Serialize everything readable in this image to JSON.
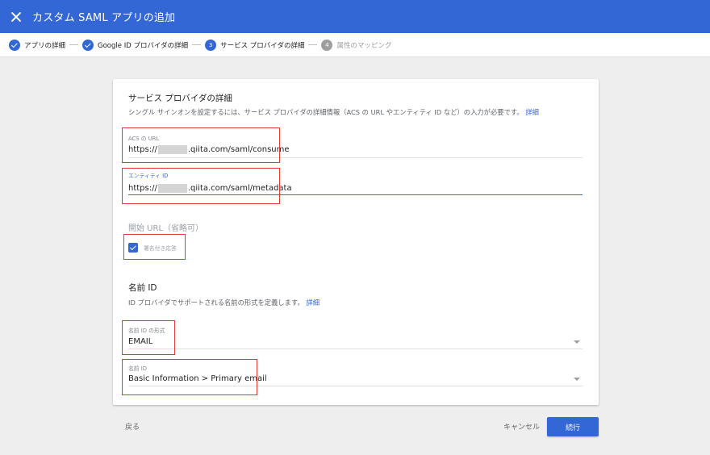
{
  "header": {
    "title": "カスタム SAML アプリの追加",
    "close_icon": "close-icon"
  },
  "stepper": {
    "steps": [
      {
        "label": "アプリの詳細",
        "status": "done"
      },
      {
        "label": "Google ID プロバイダの詳細",
        "status": "done"
      },
      {
        "label": "サービス プロバイダの詳細",
        "status": "current",
        "number": "3"
      },
      {
        "label": "属性のマッピング",
        "status": "pending",
        "number": "4"
      }
    ]
  },
  "service_provider": {
    "title": "サービス プロバイダの詳細",
    "description": "シングル サインオンを設定するには、サービス プロバイダの詳細情報（ACS の URL やエンティティ ID など）の入力が必要です。",
    "details_link": "詳細",
    "acs_url": {
      "label": "ACS の URL",
      "value_prefix": "https://",
      "value_suffix": ".qiita.com/saml/consume"
    },
    "entity_id": {
      "label": "エンティティ ID",
      "value_prefix": "https://",
      "value_suffix": ".qiita.com/saml/metadata"
    },
    "start_url": {
      "placeholder": "開始 URL（省略可）"
    },
    "signed_response": {
      "label": "署名付き応答",
      "checked": true
    }
  },
  "name_id": {
    "title": "名前 ID",
    "description": "ID プロバイダでサポートされる名前の形式を定義します。",
    "details_link": "詳細",
    "format": {
      "label": "名前 ID の形式",
      "value": "EMAIL"
    },
    "name_id_field": {
      "label": "名前 ID",
      "value": "Basic Information > Primary email"
    }
  },
  "footer": {
    "back_label": "戻る",
    "cancel_label": "キャンセル",
    "continue_label": "続行"
  },
  "colors": {
    "accent": "#3367d6",
    "highlight": "#e53935"
  }
}
